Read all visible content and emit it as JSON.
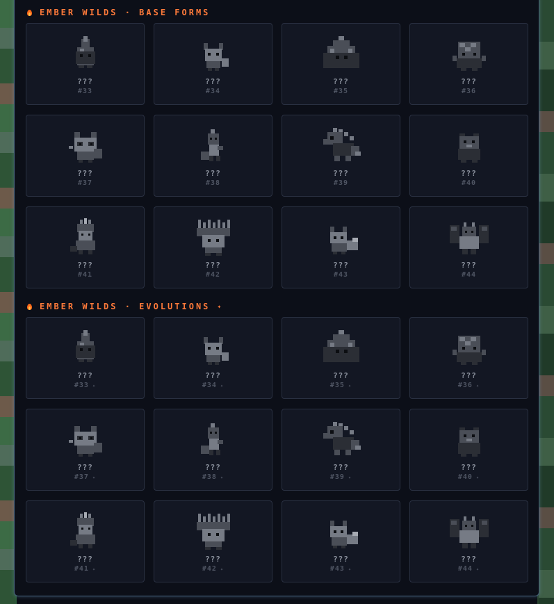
{
  "sections": [
    {
      "title": "EMBER WILDS · BASE FORMS",
      "show_sparkle": false,
      "cards": [
        {
          "name": "???",
          "number": "#33",
          "sprite": "flame-blob"
        },
        {
          "name": "???",
          "number": "#34",
          "sprite": "fox"
        },
        {
          "name": "???",
          "number": "#35",
          "sprite": "fire-spirit"
        },
        {
          "name": "???",
          "number": "#36",
          "sprite": "rock-golem"
        },
        {
          "name": "???",
          "number": "#37",
          "sprite": "raccoon"
        },
        {
          "name": "???",
          "number": "#38",
          "sprite": "ember-imp"
        },
        {
          "name": "???",
          "number": "#39",
          "sprite": "spiked-lizard"
        },
        {
          "name": "???",
          "number": "#40",
          "sprite": "bear"
        },
        {
          "name": "???",
          "number": "#41",
          "sprite": "crystal-dragon"
        },
        {
          "name": "???",
          "number": "#42",
          "sprite": "porcupine"
        },
        {
          "name": "???",
          "number": "#43",
          "sprite": "fox-kit"
        },
        {
          "name": "???",
          "number": "#44",
          "sprite": "winged-dragon"
        }
      ]
    },
    {
      "title": "EMBER WILDS · EVOLUTIONS",
      "show_sparkle": true,
      "sparkle": "✦",
      "cards": [
        {
          "name": "???",
          "number": "#33",
          "star": "✦",
          "sprite": "flame-blob"
        },
        {
          "name": "???",
          "number": "#34",
          "star": "✦",
          "sprite": "fox"
        },
        {
          "name": "???",
          "number": "#35",
          "star": "✦",
          "sprite": "fire-spirit"
        },
        {
          "name": "???",
          "number": "#36",
          "star": "✦",
          "sprite": "rock-golem"
        },
        {
          "name": "???",
          "number": "#37",
          "star": "✦",
          "sprite": "raccoon"
        },
        {
          "name": "???",
          "number": "#38",
          "star": "✦",
          "sprite": "ember-imp"
        },
        {
          "name": "???",
          "number": "#39",
          "star": "✦",
          "sprite": "spiked-lizard"
        },
        {
          "name": "???",
          "number": "#40",
          "star": "✦",
          "sprite": "bear"
        },
        {
          "name": "???",
          "number": "#41",
          "star": "✦",
          "sprite": "crystal-dragon"
        },
        {
          "name": "???",
          "number": "#42",
          "star": "✦",
          "sprite": "porcupine"
        },
        {
          "name": "???",
          "number": "#43",
          "star": "✦",
          "sprite": "fox-kit"
        },
        {
          "name": "???",
          "number": "#44",
          "star": "✦",
          "sprite": "winged-dragon"
        }
      ]
    }
  ],
  "colors": {
    "accent": "#ff7a3a",
    "panel": "#0c0f18",
    "card": "#131723",
    "card_border": "#2a3142",
    "name": "#8a909c",
    "number": "#4f5563"
  }
}
